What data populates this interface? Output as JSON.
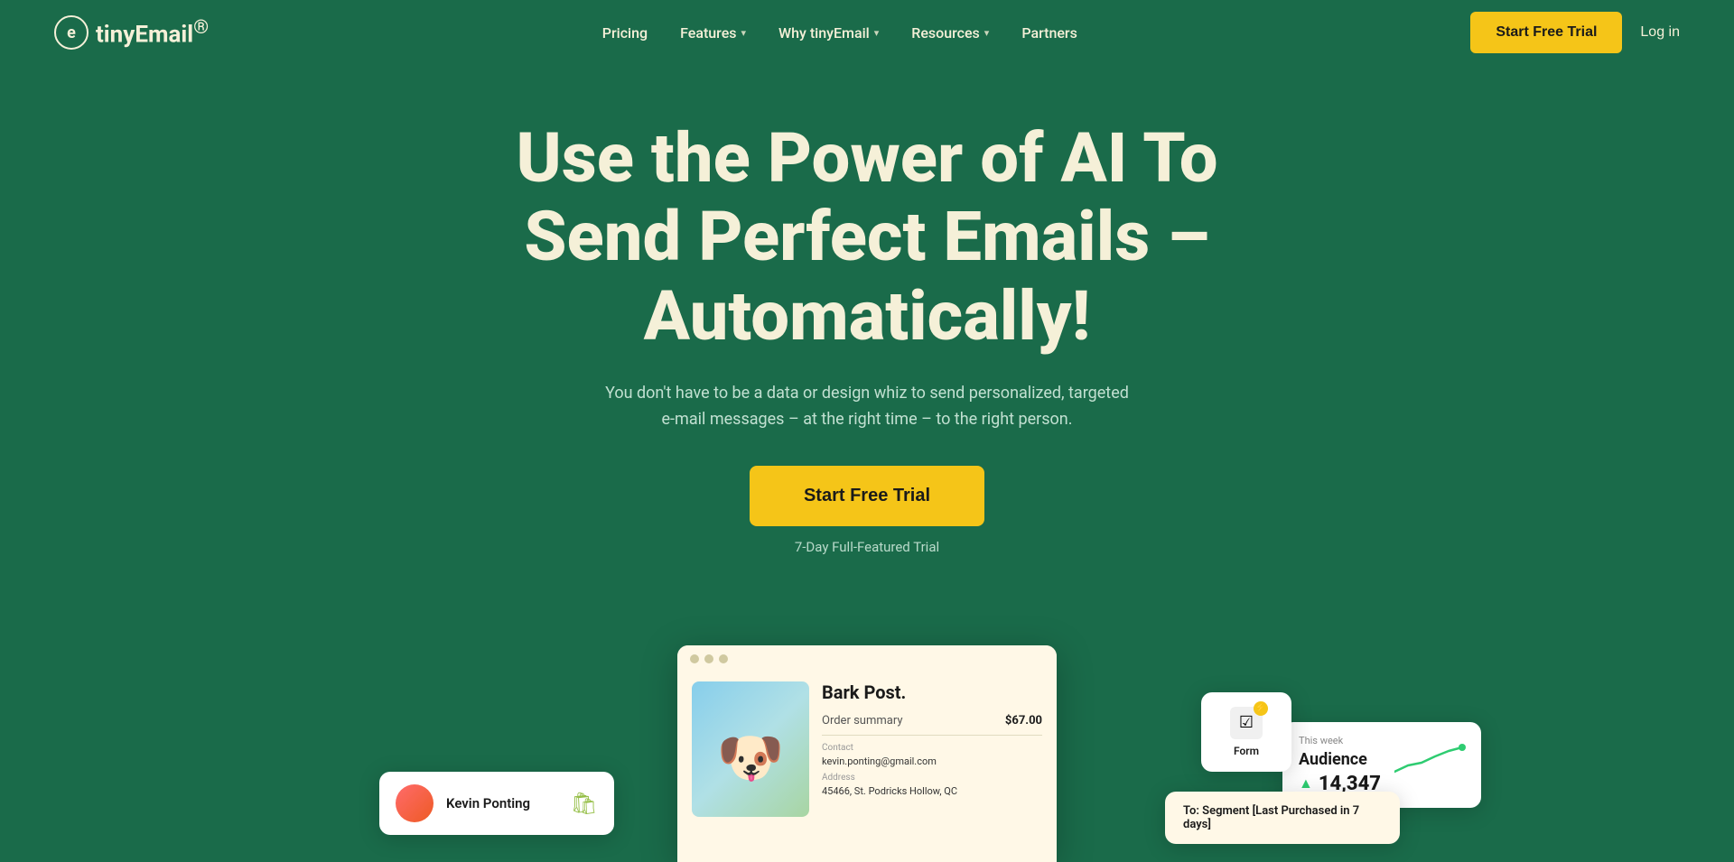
{
  "brand": {
    "logo_letter": "e",
    "name_prefix": "tiny",
    "name_suffix": "Email",
    "trademark": "®"
  },
  "navbar": {
    "links": [
      {
        "label": "Pricing",
        "has_dropdown": false
      },
      {
        "label": "Features",
        "has_dropdown": true
      },
      {
        "label": "Why tinyEmail",
        "has_dropdown": true
      },
      {
        "label": "Resources",
        "has_dropdown": true
      },
      {
        "label": "Partners",
        "has_dropdown": false
      }
    ],
    "cta_label": "Start Free Trial",
    "login_label": "Log in"
  },
  "hero": {
    "title": "Use the Power of AI To Send Perfect Emails – Automatically!",
    "subtitle": "You don't have to be a data or design whiz to send personalized, targeted e-mail messages – at the right time – to the right person.",
    "cta_label": "Start Free Trial",
    "trial_note": "7-Day Full-Featured Trial"
  },
  "mockup": {
    "browser": {
      "brand": "Bark Post.",
      "order_label": "Order summary",
      "order_price": "$67.00",
      "contact_label": "Contact",
      "contact_email": "kevin.ponting@gmail.com",
      "address_label": "Address",
      "address_text": "45466, St. Podricks Hollow, QC"
    },
    "audience_card": {
      "week_label": "This week",
      "title": "Audience",
      "count": "14,347"
    },
    "form_card": {
      "label": "Form"
    },
    "customer_card": {
      "name": "Kevin Ponting"
    },
    "segment_card": {
      "to_label": "To:",
      "segment": "Segment [Last Purchased in 7 days]"
    }
  },
  "colors": {
    "bg": "#1a6b4a",
    "cream": "#f5f0d8",
    "yellow": "#f5c518",
    "text_light": "#d4ede0"
  }
}
